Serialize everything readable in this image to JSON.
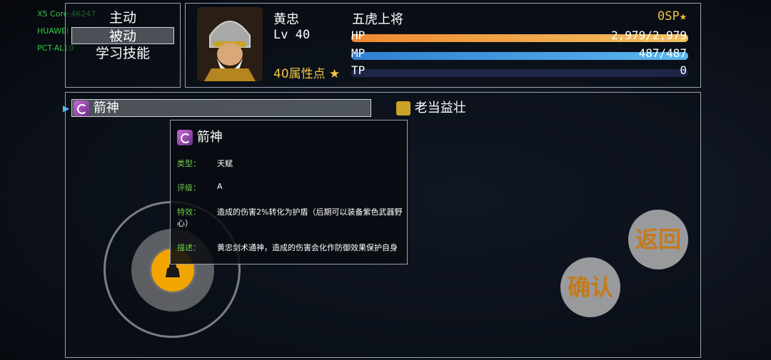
{
  "debug": {
    "line1": "X5 Core:46247",
    "line2": "HUAWEI",
    "line3": "PCT-AL10"
  },
  "menu": {
    "items": [
      "主动",
      "被动",
      "学习技能"
    ],
    "selected": 1
  },
  "hero": {
    "name": "黄忠",
    "title": "五虎上将",
    "level": "Lv 40",
    "sp": "0SP",
    "attr_points": "40属性点",
    "hp": {
      "label": "HP",
      "value": "2,979/2,979",
      "fraction": 1.0
    },
    "mp": {
      "label": "MP",
      "value": "487/487",
      "fraction": 1.0
    },
    "tp": {
      "label": "TP",
      "value": "0",
      "fraction": 0.0
    }
  },
  "skills": {
    "list": [
      "箭神",
      "老当益壮"
    ],
    "selected": 0
  },
  "tooltip": {
    "title": "箭神",
    "type_label": "类型：",
    "type_value": "天赋",
    "grade_label": "评级：",
    "grade_value": "A",
    "effect_label": "特效：",
    "effect_value_line1": "造成的伤害2%转化为护盾（后期可以装备紫色武器野",
    "effect_value_line2": "心）",
    "desc_label": "描述：",
    "desc_value": "黄忠剑术通神，造成的伤害会化作防御效果保护自身"
  },
  "buttons": {
    "back": "返回",
    "confirm": "确认"
  },
  "colors": {
    "hp": "#f0a040",
    "mp": "#3a9fe0",
    "tp": "#1e2648",
    "accent": "#f4c542"
  }
}
